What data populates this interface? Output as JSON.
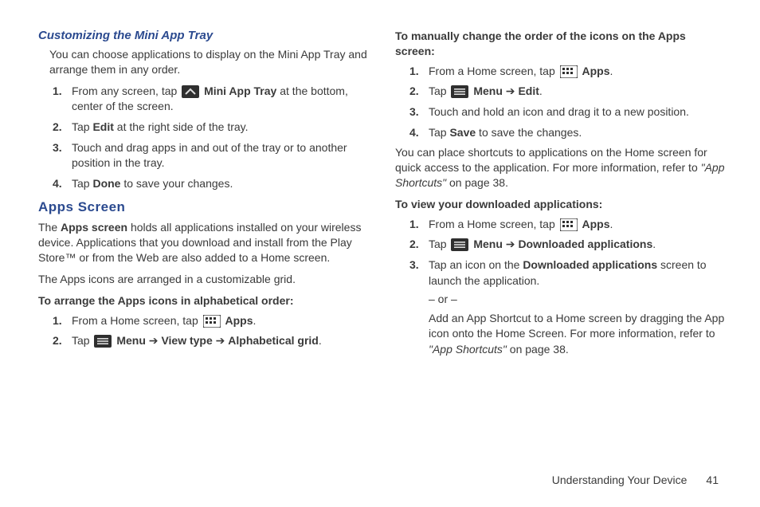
{
  "left": {
    "heading1": "Customizing the Mini App Tray",
    "intro": "You can choose applications to display on the Mini App Tray and arrange them in any order.",
    "steps1": [
      {
        "num": "1.",
        "pre": "From any screen, tap ",
        "bold1": "Mini App Tray",
        "post": " at the bottom, center of the screen."
      },
      {
        "num": "2.",
        "pre": "Tap ",
        "bold1": "Edit",
        "post": " at the right side of the tray."
      },
      {
        "num": "3.",
        "text": "Touch and drag apps in and out of the tray or to another position in the tray."
      },
      {
        "num": "4.",
        "pre": "Tap ",
        "bold1": "Done",
        "post": " to save your changes."
      }
    ],
    "heading2": "Apps Screen",
    "para1_pre": "The ",
    "para1_bold": "Apps screen",
    "para1_post": " holds all applications installed on your wireless device. Applications that you download and install from the Play Store™ or from the Web are also added to a Home screen.",
    "para2": "The Apps icons are arranged in a customizable grid.",
    "bold_lead1": "To arrange the Apps icons in alphabetical order:",
    "steps2": [
      {
        "num": "1.",
        "pre": "From a Home screen, tap ",
        "bold1": "Apps",
        "post": "."
      },
      {
        "num": "2.",
        "pre": "Tap ",
        "bold1": "Menu",
        "arrow": " ➔ ",
        "bold2": "View type",
        "arrow2": " ➔ ",
        "bold3": "Alphabetical grid",
        "post": "."
      }
    ]
  },
  "right": {
    "bold_lead1": "To manually change the order of the icons on the Apps screen:",
    "steps1": [
      {
        "num": "1.",
        "pre": "From a Home screen, tap ",
        "bold1": "Apps",
        "post": "."
      },
      {
        "num": "2.",
        "pre": "Tap ",
        "bold1": "Menu",
        "arrow": " ➔ ",
        "bold2": "Edit",
        "post": "."
      },
      {
        "num": "3.",
        "text": "Touch and hold an icon and drag it to a new position."
      },
      {
        "num": "4.",
        "pre": "Tap ",
        "bold1": "Save",
        "post": " to save the changes."
      }
    ],
    "para1_pre": "You can place shortcuts to applications on the Home screen for quick access to the application. For more information, refer to ",
    "para1_ref": "\"App Shortcuts\"",
    "para1_post": "  on page 38.",
    "bold_lead2": "To view your downloaded applications:",
    "steps2": [
      {
        "num": "1.",
        "pre": "From a Home screen, tap ",
        "bold1": "Apps",
        "post": "."
      },
      {
        "num": "2.",
        "pre": "Tap ",
        "bold1": "Menu",
        "arrow": " ➔ ",
        "bold2": "Downloaded applications",
        "post": "."
      },
      {
        "num": "3.",
        "pre": "Tap an icon on the ",
        "bold1": "Downloaded applications",
        "post": " screen to launch the application.",
        "sub1": "– or –",
        "sub2_pre": "Add an App Shortcut to a Home screen by dragging the App icon onto the Home Screen. For more information, refer to ",
        "sub2_ref": "\"App Shortcuts\"",
        "sub2_post": "  on page 38."
      }
    ]
  },
  "footer": {
    "section": "Understanding Your Device",
    "page": "41"
  }
}
